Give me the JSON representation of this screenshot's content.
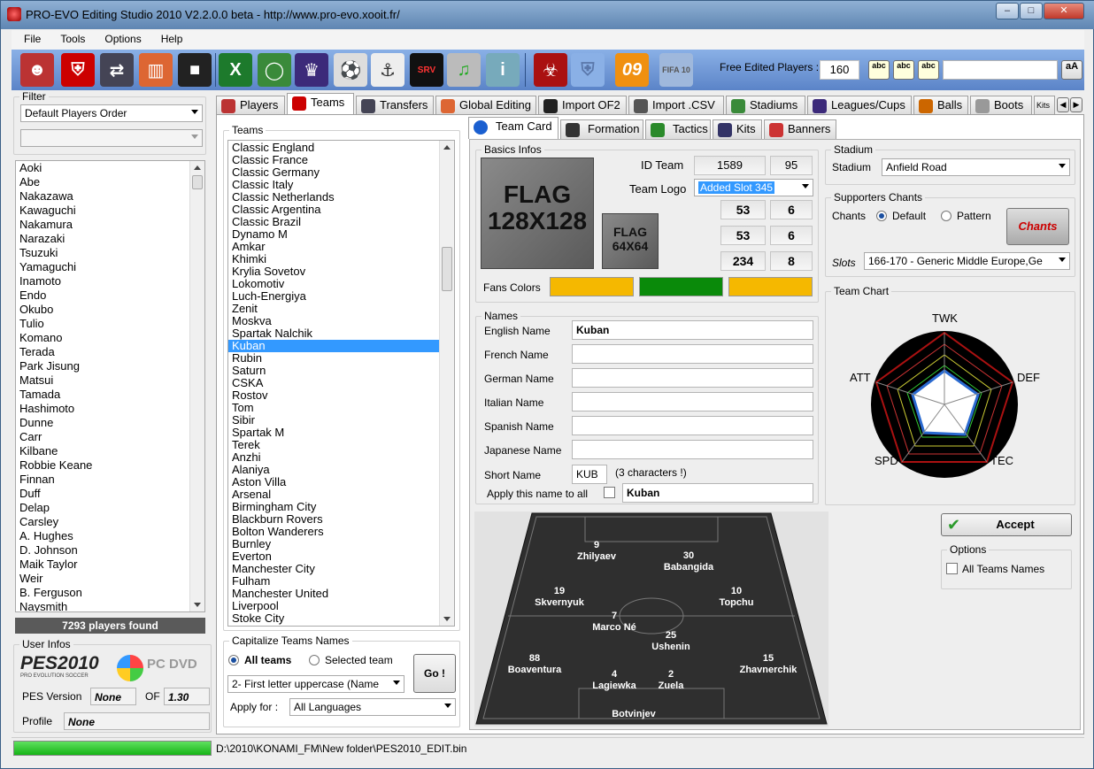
{
  "window": {
    "title": "PRO-EVO Editing Studio 2010 V2.2.0.0 beta  -  http://www.pro-evo.xooit.fr/"
  },
  "menu": [
    "File",
    "Tools",
    "Options",
    "Help"
  ],
  "toolbar": {
    "free_players_label": "Free Edited Players :",
    "free_players_value": "160",
    "search_value": "",
    "abc1": "abc",
    "abc2": "abc",
    "abc3": "abc",
    "case_btn": "aA",
    "badge09": "09",
    "fifa": "FIFA 10"
  },
  "filter": {
    "label": "Filter",
    "order": "Default Players Order",
    "sub": ""
  },
  "players": {
    "items": [
      "Aoki",
      "Abe",
      "Nakazawa",
      "Kawaguchi",
      "Nakamura",
      "Narazaki",
      "Tsuzuki",
      "Yamaguchi",
      "Inamoto",
      "Endo",
      "Okubo",
      "Tulio",
      "Komano",
      "Terada",
      "Park Jisung",
      "Matsui",
      "Tamada",
      "Hashimoto",
      "Dunne",
      "Carr",
      "Kilbane",
      "Robbie Keane",
      "Finnan",
      "Duff",
      "Delap",
      "Carsley",
      "A. Hughes",
      "D. Johnson",
      "Maik Taylor",
      "Weir",
      "B. Ferguson",
      "Naysmith"
    ],
    "found": "7293 players found"
  },
  "user_infos": {
    "label": "User Infos",
    "pes_logo": "PES2010",
    "pes_sub": "PRO EVOLUTION SOCCER",
    "pc_dvd": "PC DVD",
    "pes_version_label": "PES Version",
    "pes_version_value": "None",
    "of_label": "OF",
    "of_value": "1.30",
    "profile_label": "Profile",
    "profile_value": "None"
  },
  "tabs": [
    "Players",
    "Teams",
    "Transfers",
    "Global Editing",
    "Import OF2",
    "Import .CSV",
    "Stadiums",
    "Leagues/Cups",
    "Balls",
    "Boots",
    "Kits"
  ],
  "teams": {
    "label": "Teams",
    "items": [
      "Classic England",
      "Classic France",
      "Classic Germany",
      "Classic Italy",
      "Classic Netherlands",
      "Classic Argentina",
      "Classic Brazil",
      "Dynamo M",
      "Amkar",
      "Khimki",
      "Krylia Sovetov",
      "Lokomotiv",
      "Luch-Energiya",
      "Zenit",
      "Moskva",
      "Spartak Nalchik",
      "Kuban",
      "Rubin",
      "Saturn",
      "CSKA",
      "Rostov",
      "Tom",
      "Sibir",
      "Spartak M",
      "Terek",
      "Anzhi",
      "Alaniya",
      "Aston Villa",
      "Arsenal",
      "Birmingham City",
      "Blackburn Rovers",
      "Bolton Wanderers",
      "Burnley",
      "Everton",
      "Manchester City",
      "Fulham",
      "Manchester United",
      "Liverpool",
      "Stoke City"
    ],
    "selected": "Kuban"
  },
  "capitalize": {
    "label": "Capitalize Teams Names",
    "all": "All teams",
    "selected": "Selected team",
    "mode": "2- First letter uppercase (Name",
    "apply_label": "Apply for :",
    "apply_value": "All Languages",
    "go": "Go !"
  },
  "subtabs": [
    "Team Card",
    "Formation",
    "Tactics",
    "Kits",
    "Banners"
  ],
  "basics": {
    "label": "Basics Infos",
    "flag_big_line1": "FLAG",
    "flag_big_line2": "128X128",
    "flag_small_line1": "FLAG",
    "flag_small_line2": "64X64",
    "id_team_label": "ID Team",
    "id_team": "1589",
    "id_team2": "95",
    "logo_label": "Team Logo",
    "logo_value": "Added Slot 345",
    "n1": "53",
    "n2": "6",
    "n3": "53",
    "n4": "6",
    "n5": "234",
    "n6": "8",
    "fans_label": "Fans Colors",
    "fans_colors": [
      "#f5b800",
      "#0a8a0a",
      "#f5b800"
    ]
  },
  "names": {
    "label": "Names",
    "english_label": "English Name",
    "english": "Kuban",
    "french_label": "French Name",
    "french": "",
    "german_label": "German Name",
    "german": "",
    "italian_label": "Italian Name",
    "italian": "",
    "spanish_label": "Spanish Name",
    "spanish": "",
    "japanese_label": "Japanese Name",
    "japanese": "",
    "short_label": "Short Name",
    "short": "KUB",
    "short_hint": "(3 characters !)",
    "apply_all_label": "Apply this name to all",
    "apply_all": "Kuban"
  },
  "stadium": {
    "label": "Stadium",
    "field_label": "Stadium",
    "value": "Anfield Road"
  },
  "chants": {
    "label": "Supporters Chants",
    "chants_label": "Chants",
    "default": "Default",
    "pattern": "Pattern",
    "logo_text": "Chants",
    "slots_label": "Slots",
    "slots_value": "166-170 - Generic Middle Europe,Ge"
  },
  "chart": {
    "label": "Team Chart",
    "twk": "TWK",
    "def": "DEF",
    "tec": "TEC",
    "spd": "SPD",
    "att": "ATT"
  },
  "accept": "Accept",
  "options": {
    "label": "Options",
    "all_names": "All Teams Names"
  },
  "formation": [
    {
      "num": "9",
      "name": "Zhilyaev"
    },
    {
      "num": "30",
      "name": "Babangida"
    },
    {
      "num": "19",
      "name": "Skvernyuk"
    },
    {
      "num": "10",
      "name": "Topchu"
    },
    {
      "num": "7",
      "name": "Marco Né"
    },
    {
      "num": "25",
      "name": "Ushenin"
    },
    {
      "num": "88",
      "name": "Boaventura"
    },
    {
      "num": "15",
      "name": "Zhavnerchik"
    },
    {
      "num": "4",
      "name": "Lagiewka"
    },
    {
      "num": "2",
      "name": "Zuela"
    },
    {
      "num": "",
      "name": "Botvinjev"
    }
  ],
  "status": {
    "path": "D:\\2010\\KONAMI_FM\\New folder\\PES2010_EDIT.bin"
  }
}
